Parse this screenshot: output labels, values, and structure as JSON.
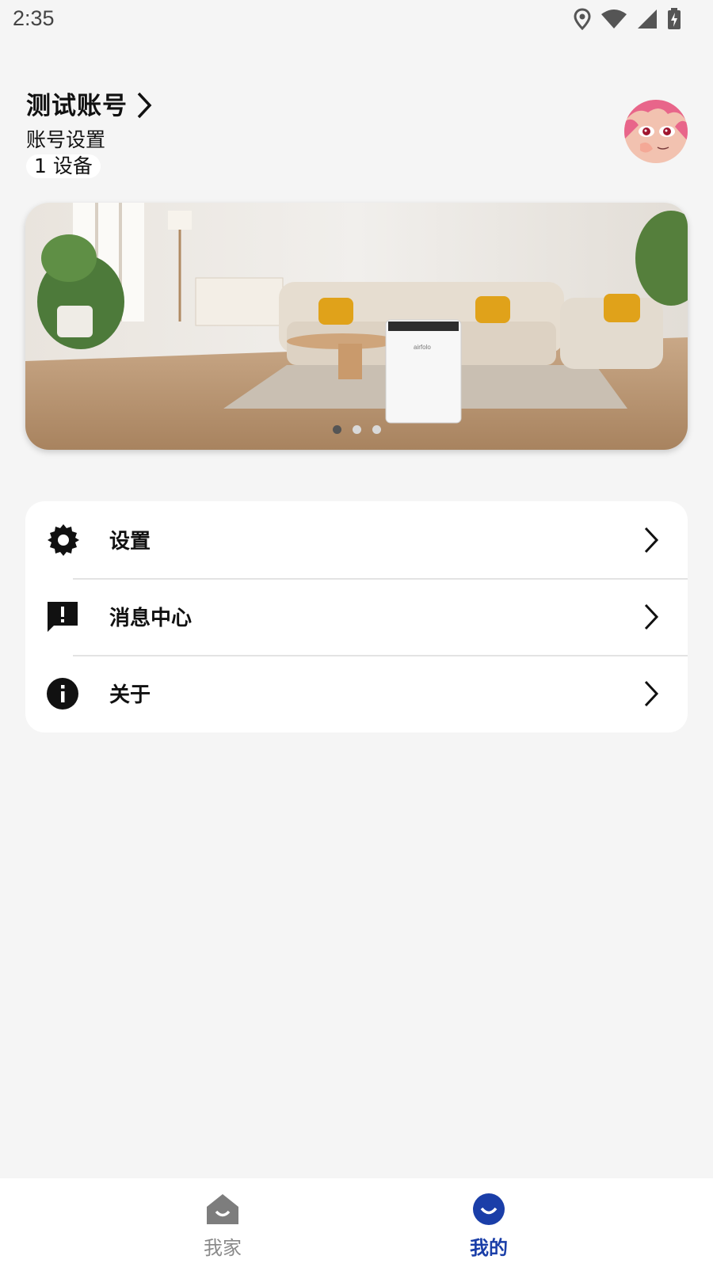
{
  "status_bar": {
    "time": "2:35",
    "icons": [
      "location-icon",
      "wifi-icon",
      "cellular-signal-icon",
      "battery-charging-icon"
    ]
  },
  "profile": {
    "account_name": "测试账号",
    "account_settings": "账号设置",
    "device_count": "1 设备"
  },
  "banner": {
    "slides": 3,
    "active_slide": 1
  },
  "menu": {
    "items": [
      {
        "label": "设置",
        "icon": "settings-gear-icon"
      },
      {
        "label": "消息中心",
        "icon": "message-alert-icon"
      },
      {
        "label": "关于",
        "icon": "info-icon"
      }
    ]
  },
  "bottom_nav": {
    "items": [
      {
        "label": "我家",
        "icon": "home-icon",
        "active": false
      },
      {
        "label": "我的",
        "icon": "smile-icon",
        "active": true
      }
    ],
    "active_color": "#1a3ea8",
    "inactive_color": "#8a8a8a"
  }
}
